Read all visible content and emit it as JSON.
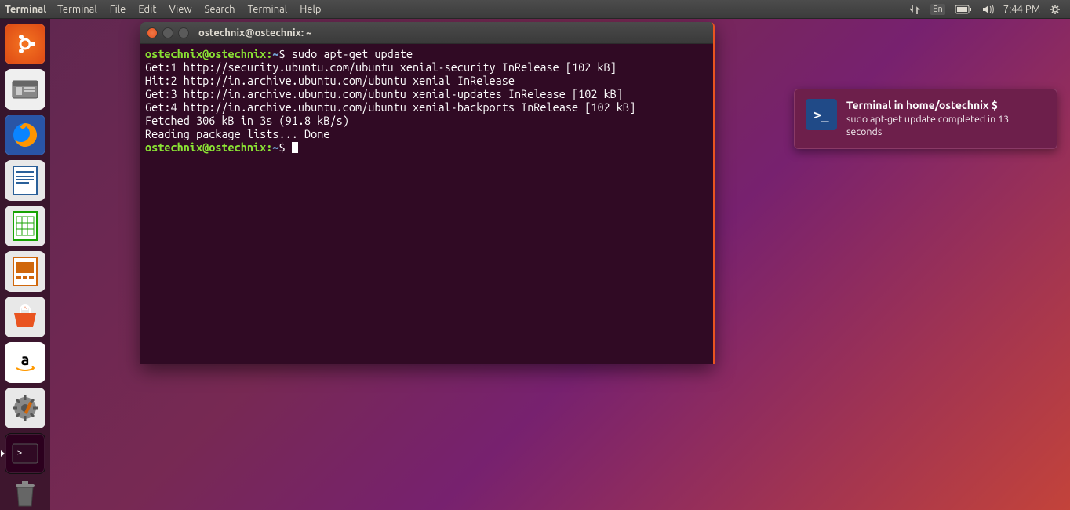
{
  "top_bar": {
    "app_name": "Terminal",
    "menus": [
      "Terminal",
      "File",
      "Edit",
      "View",
      "Search",
      "Terminal",
      "Help"
    ],
    "lang": "En",
    "time": "7:44 PM"
  },
  "launcher": {
    "items": [
      {
        "name": "ubuntu-dash",
        "cls": "ubuntu"
      },
      {
        "name": "files",
        "cls": "files"
      },
      {
        "name": "firefox",
        "cls": "firefox"
      },
      {
        "name": "libreoffice-writer",
        "cls": "writer"
      },
      {
        "name": "libreoffice-calc",
        "cls": "calc"
      },
      {
        "name": "libreoffice-impress",
        "cls": "impress"
      },
      {
        "name": "ubuntu-software",
        "cls": "software"
      },
      {
        "name": "amazon",
        "cls": "amazon"
      },
      {
        "name": "system-settings",
        "cls": "settings"
      },
      {
        "name": "terminal",
        "cls": "terminal"
      },
      {
        "name": "trash",
        "cls": "trash"
      }
    ]
  },
  "terminal": {
    "title": "ostechnix@ostechnix: ~",
    "prompt_user": "ostechnix@ostechnix",
    "prompt_path": "~",
    "command": "sudo apt-get update",
    "output_lines": [
      "Get:1 http://security.ubuntu.com/ubuntu xenial-security InRelease [102 kB]",
      "Hit:2 http://in.archive.ubuntu.com/ubuntu xenial InRelease",
      "Get:3 http://in.archive.ubuntu.com/ubuntu xenial-updates InRelease [102 kB]",
      "Get:4 http://in.archive.ubuntu.com/ubuntu xenial-backports InRelease [102 kB]",
      "Fetched 306 kB in 3s (91.8 kB/s)",
      "Reading package lists... Done"
    ]
  },
  "notification": {
    "icon_text": ">_",
    "title": "Terminal in home/ostechnix $",
    "body": "sudo apt-get update completed in 13 seconds"
  }
}
